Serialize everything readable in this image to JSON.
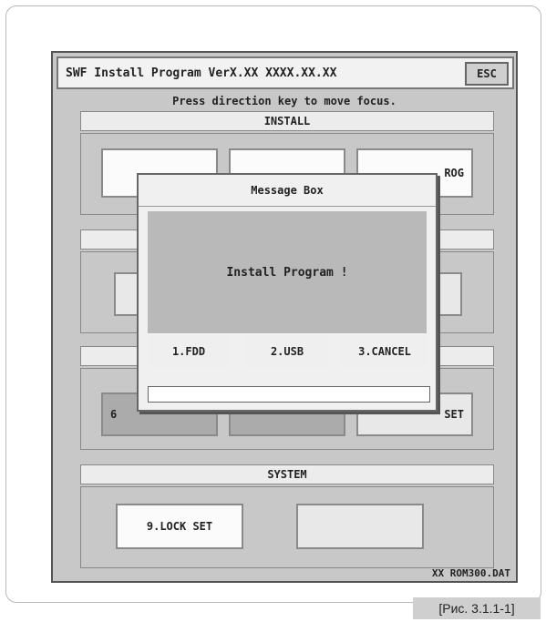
{
  "app": {
    "title": "SWF Install Program VerX.XX XXXX.XX.XX",
    "esc_label": "ESC",
    "hint": "Press direction key to move focus."
  },
  "sections": {
    "install": {
      "header": "INSTALL",
      "buttons": [
        {
          "label": ""
        },
        {
          "label": ""
        },
        {
          "label": "ROG"
        }
      ]
    },
    "middle": {
      "header": ""
    },
    "config": {
      "header": "",
      "buttons": [
        {
          "label": "6"
        },
        {
          "label": ""
        },
        {
          "label": "SET"
        }
      ]
    },
    "system": {
      "header": "SYSTEM",
      "buttons": [
        {
          "label": "9.LOCK SET"
        },
        {
          "label": ""
        }
      ]
    }
  },
  "dialog": {
    "title": "Message Box",
    "message": "Install Program !",
    "options": [
      "1.FDD",
      "2.USB",
      "3.CANCEL"
    ],
    "input_value": ""
  },
  "footer": {
    "file": "XX ROM300.DAT"
  },
  "figure_caption": "[Рис. 3.1.1-1]"
}
